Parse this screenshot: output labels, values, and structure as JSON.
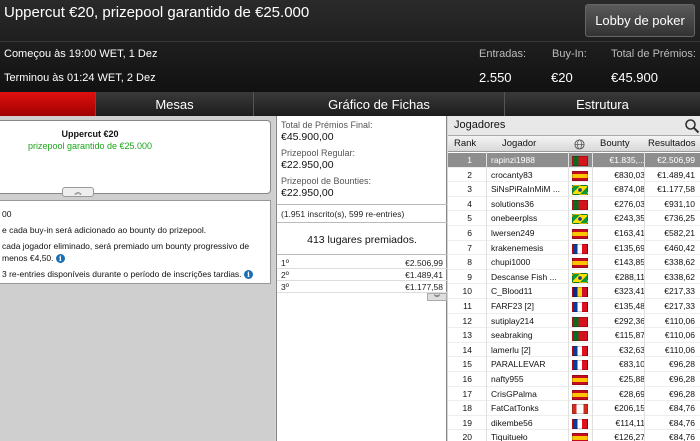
{
  "header": {
    "title": "Uppercut €20, prizepool garantido de €25.000",
    "lobby_button": "Lobby de poker",
    "started": "Começou às 19:00 WET, 1 Dez",
    "finished": "Terminou às 01:24 WET, 2 Dez",
    "stats": [
      {
        "label": "Entradas:",
        "value": "2.550"
      },
      {
        "label": "Buy-In:",
        "value": "€20"
      },
      {
        "label": "Total de Prémios:",
        "value": "€45.900"
      }
    ]
  },
  "tabs": [
    {
      "label": ""
    },
    {
      "label": "Mesas"
    },
    {
      "label": "Gráfico de Fichas"
    },
    {
      "label": "Estrutura"
    }
  ],
  "promo": {
    "line1": "Uppercut €20",
    "line2": "prizepool garantido de €25.000",
    "expand_glyph": "︽"
  },
  "info": {
    "line1": "00",
    "line2": "e cada buy-in será adicionado ao bounty do prizepool.",
    "line3": "cada jogador eliminado, será premiado um bounty progressivo de",
    "line4": "menos €4,50.",
    "line5": "3 re-entries disponíveis durante o período de inscrições tardias.",
    "info_glyph": "i"
  },
  "prize_info": {
    "total_label": "Total de Prémios Final:",
    "total_value": "€45.900,00",
    "regular_label": "Prizepool Regular:",
    "regular_value": "€22.950,00",
    "bounties_label": "Prizepool de Bounties:",
    "bounties_value": "€22.950,00",
    "entries_text": "(1.951 inscrito(s), 599 re-entries)",
    "places_text": "413 lugares premiados.",
    "places": [
      {
        "place": "1º",
        "amount": "€2.506,99"
      },
      {
        "place": "2º",
        "amount": "€1.489,41"
      },
      {
        "place": "3º",
        "amount": "€1.177,58"
      }
    ],
    "more_glyph": "︾"
  },
  "players": {
    "title": "Jogadores",
    "columns": {
      "rank": "Rank",
      "player": "Jogador",
      "bounty": "Bounty",
      "results": "Resultados"
    },
    "rows": [
      {
        "rank": "1",
        "name": "rapinzi1988",
        "flag": "pt",
        "bounty": "€1.835,...",
        "result": "€2.506,99",
        "selected": true
      },
      {
        "rank": "2",
        "name": "crocanty83",
        "flag": "es",
        "bounty": "€830,03",
        "result": "€1.489,41"
      },
      {
        "rank": "3",
        "name": "SiNsPiRaInMiM ...",
        "flag": "br",
        "bounty": "€874,08",
        "result": "€1.177,58"
      },
      {
        "rank": "4",
        "name": "solutions36",
        "flag": "pt",
        "bounty": "€276,03",
        "result": "€931,10"
      },
      {
        "rank": "5",
        "name": "onebeerplss",
        "flag": "br",
        "bounty": "€243,35",
        "result": "€736,25"
      },
      {
        "rank": "6",
        "name": "lwersen249",
        "flag": "es",
        "bounty": "€163,41",
        "result": "€582,21"
      },
      {
        "rank": "7",
        "name": "krakenemesis",
        "flag": "fr",
        "bounty": "€135,69",
        "result": "€460,42"
      },
      {
        "rank": "8",
        "name": "chupi1000",
        "flag": "es",
        "bounty": "€143,85",
        "result": "€338,62"
      },
      {
        "rank": "9",
        "name": "Descanse Fish ...",
        "flag": "br",
        "bounty": "€288,11",
        "result": "€338,62"
      },
      {
        "rank": "10",
        "name": "C_Blood11",
        "flag": "ro",
        "bounty": "€323,41",
        "result": "€217,33"
      },
      {
        "rank": "11",
        "name": "FARF23 [2]",
        "flag": "fr",
        "bounty": "€135,48",
        "result": "€217,33"
      },
      {
        "rank": "12",
        "name": "sutiplay214",
        "flag": "pt",
        "bounty": "€292,36",
        "result": "€110,06"
      },
      {
        "rank": "13",
        "name": "seabraking",
        "flag": "pt",
        "bounty": "€115,87",
        "result": "€110,06"
      },
      {
        "rank": "14",
        "name": "lamerlu [2]",
        "flag": "fr",
        "bounty": "€32,63",
        "result": "€110,06"
      },
      {
        "rank": "15",
        "name": "PARALLEVAR",
        "flag": "fr",
        "bounty": "€83,10",
        "result": "€96,28"
      },
      {
        "rank": "16",
        "name": "nafty955",
        "flag": "es",
        "bounty": "€25,88",
        "result": "€96,28"
      },
      {
        "rank": "17",
        "name": "CrisGPalma",
        "flag": "es",
        "bounty": "€28,69",
        "result": "€96,28"
      },
      {
        "rank": "18",
        "name": "FatCatTonks",
        "flag": "ca",
        "bounty": "€206,15",
        "result": "€84,76"
      },
      {
        "rank": "19",
        "name": "dikembe56",
        "flag": "fr",
        "bounty": "€114,11",
        "result": "€84,76"
      },
      {
        "rank": "20",
        "name": "Tiquitueło",
        "flag": "es",
        "bounty": "€126,27",
        "result": "€84,76"
      }
    ]
  },
  "colors": {
    "accent": "#cc0000",
    "green": "#1aa51a"
  }
}
